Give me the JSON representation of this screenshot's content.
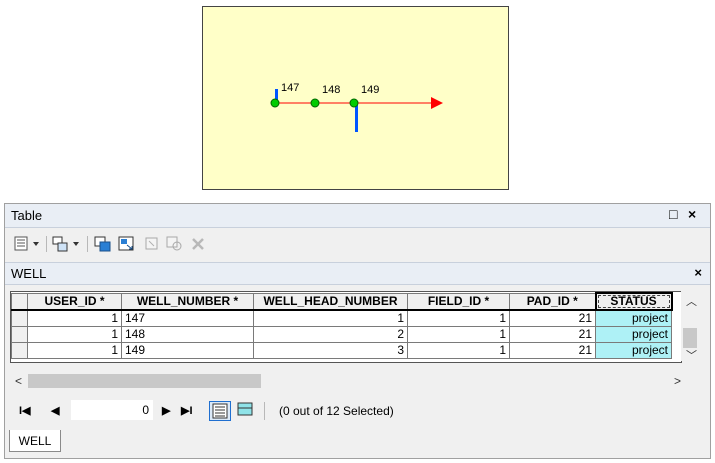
{
  "map": {
    "labels": [
      "147",
      "148",
      "149"
    ],
    "colors": {
      "background": "#ffffc8",
      "line": "#ff0000",
      "well": "#00cc00",
      "well_stick": "#0055ff"
    }
  },
  "window": {
    "title": "Table",
    "restore_icon": "□",
    "close_icon": "×"
  },
  "toolbar": {
    "icons": [
      "table-options-icon",
      "related-tables-icon",
      "select-by-attributes-icon",
      "switch-selection-icon",
      "clear-selection-icon",
      "zoom-to-selected-icon",
      "delete-selected-icon"
    ]
  },
  "layer_tab": {
    "label": "WELL",
    "close_icon": "×"
  },
  "table": {
    "columns": [
      "USER_ID *",
      "WELL_NUMBER *",
      "WELL_HEAD_NUMBER",
      "FIELD_ID *",
      "PAD_ID *",
      "STATUS"
    ],
    "rows": [
      {
        "user_id": "1",
        "well_number": "147",
        "well_head_number": "1",
        "field_id": "1",
        "pad_id": "21",
        "status": "project"
      },
      {
        "user_id": "1",
        "well_number": "148",
        "well_head_number": "2",
        "field_id": "1",
        "pad_id": "21",
        "status": "project"
      },
      {
        "user_id": "1",
        "well_number": "149",
        "well_head_number": "3",
        "field_id": "1",
        "pad_id": "21",
        "status": "project"
      }
    ],
    "status_color": "#aef1f6"
  },
  "navigation": {
    "first_icon": "I◀",
    "prev_icon": "◀",
    "current_record": "0",
    "next_icon": "▶",
    "last_icon": "▶I",
    "selection_text": "(0 out of 12 Selected)"
  },
  "bottom_tab": {
    "label": "WELL"
  }
}
